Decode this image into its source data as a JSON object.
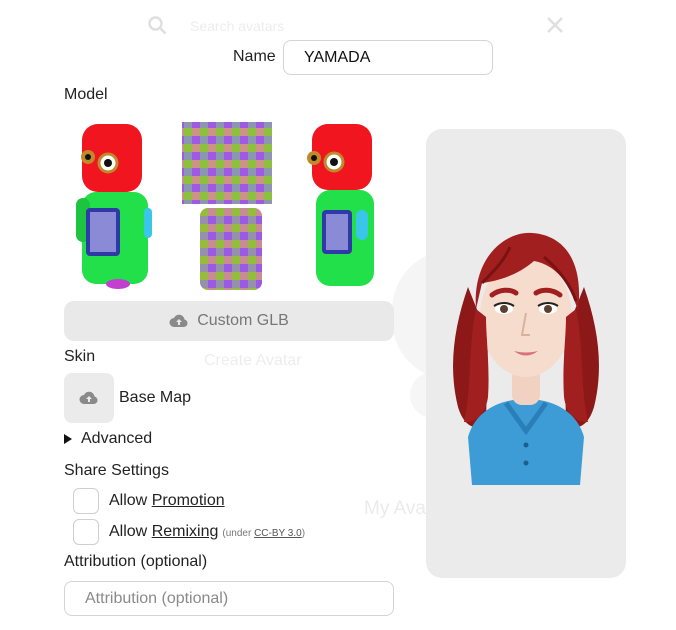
{
  "background": {
    "search_placeholder": "Search avatars",
    "create_label": "Create Avatar",
    "my_avatars_label": "My Avatars"
  },
  "name": {
    "label": "Name",
    "value": "YAMADA"
  },
  "model": {
    "label": "Model",
    "thumbnails": [
      {
        "name": "red-robot-front",
        "selected": false
      },
      {
        "name": "checker-texture-model",
        "selected": false
      },
      {
        "name": "red-robot-side",
        "selected": false
      }
    ],
    "custom_button_label": "Custom GLB",
    "upload_icon": "cloud-upload-icon"
  },
  "skin": {
    "label": "Skin",
    "base_map_label": "Base Map",
    "upload_icon": "cloud-upload-icon"
  },
  "advanced": {
    "label": "Advanced",
    "expanded": false
  },
  "share": {
    "label": "Share Settings",
    "promotion": {
      "prefix": "Allow ",
      "link": "Promotion",
      "checked": false
    },
    "remixing": {
      "prefix": "Allow ",
      "link": "Remixing",
      "note_prefix": "(under ",
      "note_link": "CC-BY 3.0",
      "note_suffix": ")",
      "checked": false
    }
  },
  "attribution": {
    "label": "Attribution (optional)",
    "placeholder": "Attribution (optional)",
    "value": ""
  },
  "colors": {
    "panel_bg": "#ebebeb",
    "button_bg": "#e9e9e9",
    "hair": "#9b1c1c",
    "shirt": "#3d9bd6"
  }
}
